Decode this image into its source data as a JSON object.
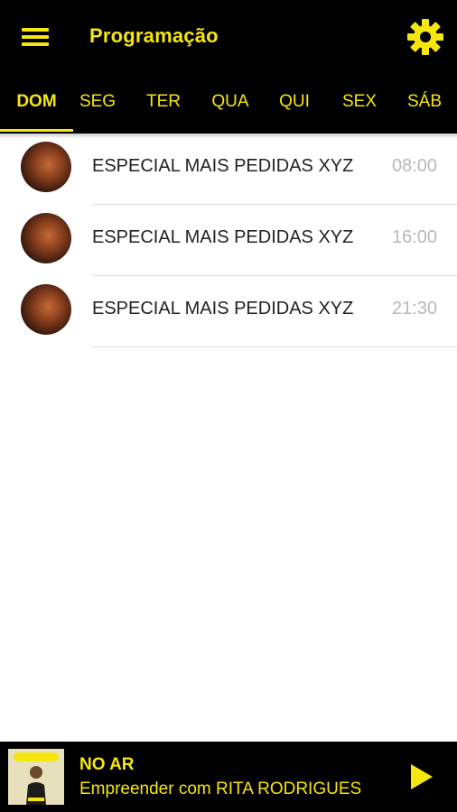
{
  "header": {
    "title": "Programação",
    "menu_icon": "hamburger-menu-icon",
    "settings_icon": "gear-icon"
  },
  "tabs": [
    {
      "label": "DOM",
      "active": true
    },
    {
      "label": "SEG",
      "active": false
    },
    {
      "label": "TER",
      "active": false
    },
    {
      "label": "QUA",
      "active": false
    },
    {
      "label": "QUI",
      "active": false
    },
    {
      "label": "SEX",
      "active": false
    },
    {
      "label": "SÁB",
      "active": false
    }
  ],
  "schedule": [
    {
      "title": "ESPECIAL MAIS PEDIDAS XYZ",
      "time": "08:00"
    },
    {
      "title": "ESPECIAL MAIS PEDIDAS XYZ",
      "time": "16:00"
    },
    {
      "title": "ESPECIAL MAIS PEDIDAS XYZ",
      "time": "21:30"
    }
  ],
  "player": {
    "status": "NO AR",
    "program": "Empreender com RITA RODRIGUES",
    "play_icon": "play-icon"
  },
  "colors": {
    "bar_background": "#000000",
    "accent": "#f6e60f",
    "time_text": "#b8b8b8",
    "title_text": "#222222"
  }
}
